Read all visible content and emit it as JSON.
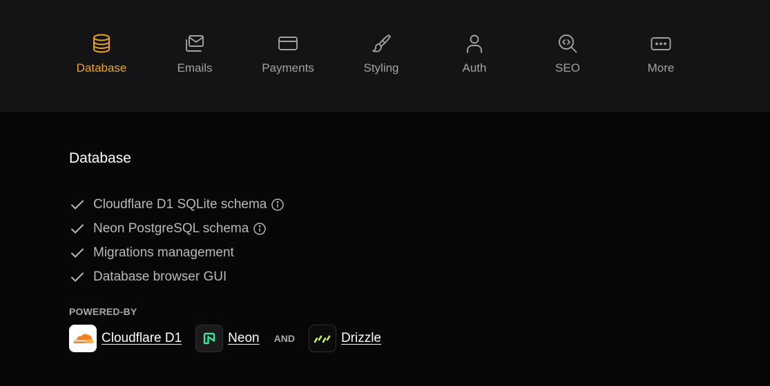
{
  "nav": {
    "tabs": [
      {
        "label": "Database",
        "icon": "database-icon",
        "active": true
      },
      {
        "label": "Emails",
        "icon": "email-icon",
        "active": false
      },
      {
        "label": "Payments",
        "icon": "credit-card-icon",
        "active": false
      },
      {
        "label": "Styling",
        "icon": "brush-icon",
        "active": false
      },
      {
        "label": "Auth",
        "icon": "user-icon",
        "active": false
      },
      {
        "label": "SEO",
        "icon": "seo-search-icon",
        "active": false
      },
      {
        "label": "More",
        "icon": "more-dots-icon",
        "active": false
      }
    ]
  },
  "section": {
    "title": "Database",
    "features": [
      {
        "text": "Cloudflare D1 SQLite schema",
        "has_info": true
      },
      {
        "text": "Neon PostgreSQL schema",
        "has_info": true
      },
      {
        "text": "Migrations management",
        "has_info": false
      },
      {
        "text": "Database browser GUI",
        "has_info": false
      }
    ],
    "powered_by_label": "POWERED-BY",
    "providers": [
      {
        "name": "Cloudflare D1",
        "icon": "cloudflare-logo"
      },
      {
        "name": "Neon",
        "icon": "neon-logo"
      },
      {
        "name": "Drizzle",
        "icon": "drizzle-logo"
      }
    ],
    "and_label": "AND"
  },
  "colors": {
    "accent": "#f0a623",
    "topbar_bg": "#141416",
    "page_bg": "#070708",
    "muted_text": "#a3a3a7"
  }
}
